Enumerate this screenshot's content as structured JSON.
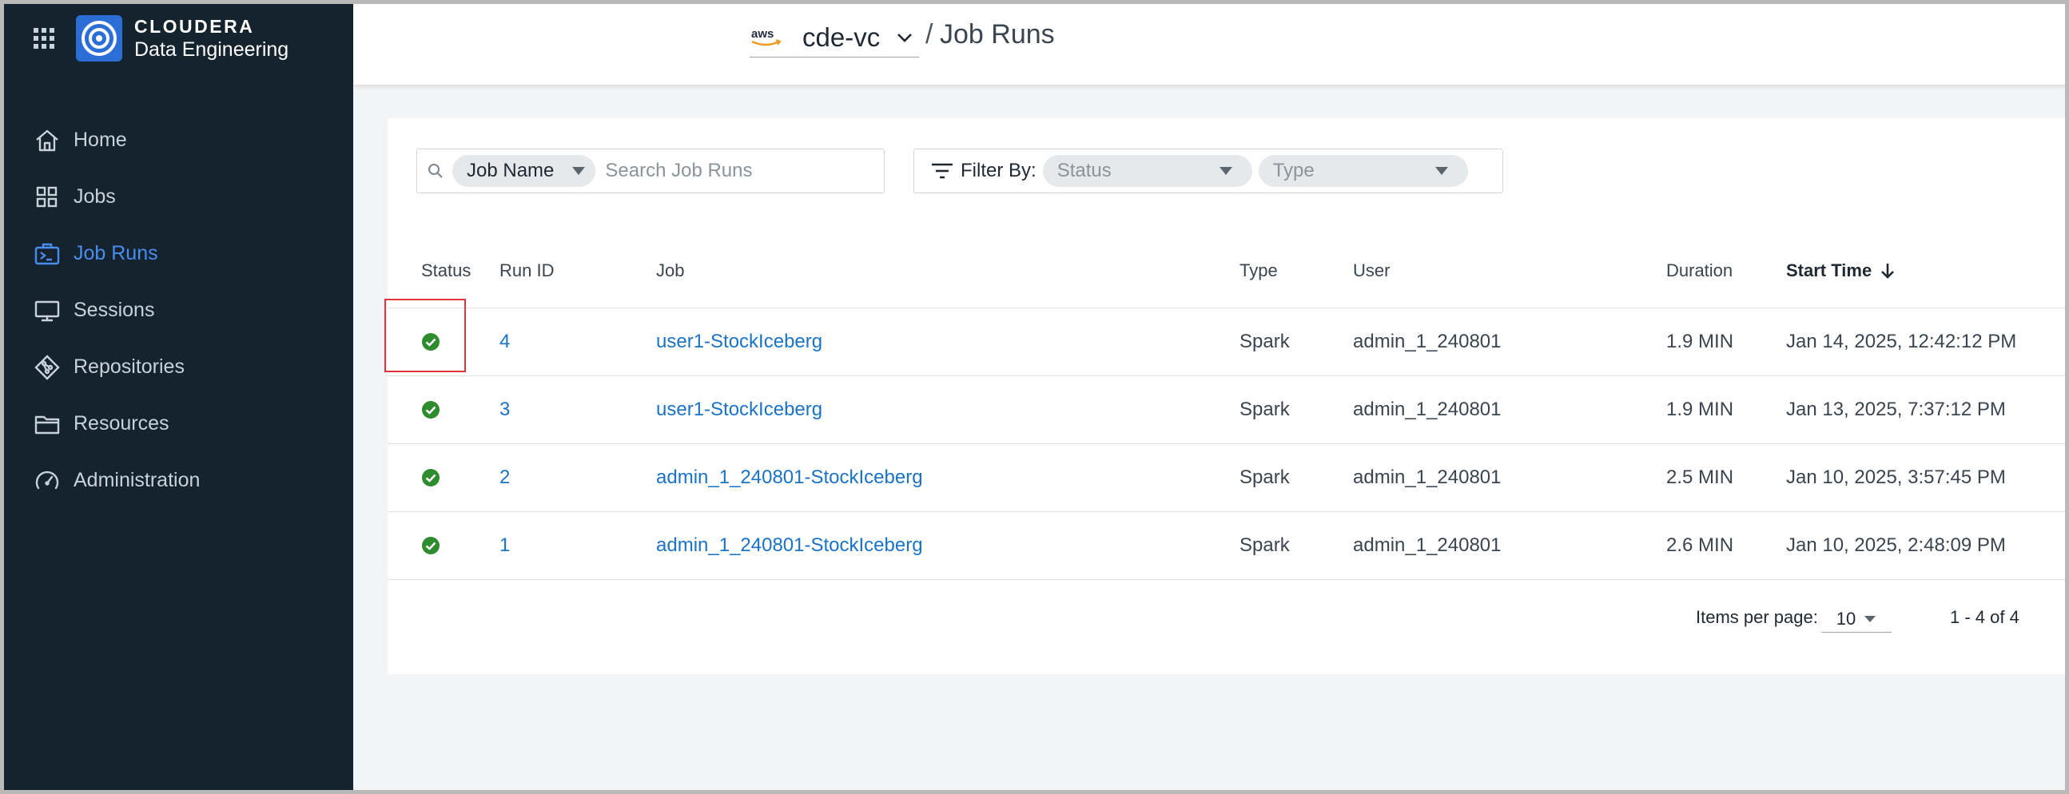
{
  "brand": {
    "title": "CLOUDERA",
    "subtitle": "Data Engineering"
  },
  "nav": [
    {
      "label": "Home",
      "icon": "home-icon",
      "active": false
    },
    {
      "label": "Jobs",
      "icon": "grid-icon",
      "active": false
    },
    {
      "label": "Job Runs",
      "icon": "job-runs-icon",
      "active": true
    },
    {
      "label": "Sessions",
      "icon": "monitor-icon",
      "active": false
    },
    {
      "label": "Repositories",
      "icon": "git-icon",
      "active": false
    },
    {
      "label": "Resources",
      "icon": "folder-icon",
      "active": false
    },
    {
      "label": "Administration",
      "icon": "gauge-icon",
      "active": false
    }
  ],
  "header": {
    "provider": "aws",
    "environment": "cde-vc",
    "separator": "/",
    "page_title": "Job Runs"
  },
  "search": {
    "field_label": "Job Name",
    "placeholder": "Search Job Runs"
  },
  "filter": {
    "label": "Filter By:",
    "status_placeholder": "Status",
    "type_placeholder": "Type"
  },
  "table": {
    "columns": {
      "status": "Status",
      "run_id": "Run ID",
      "job": "Job",
      "type": "Type",
      "user": "User",
      "duration": "Duration",
      "start_time": "Start Time"
    },
    "rows": [
      {
        "run_id": "4",
        "job": "user1-StockIceberg",
        "type": "Spark",
        "user": "admin_1_240801",
        "duration": "1.9 MIN",
        "start_time": "Jan 14, 2025, 12:42:12 PM",
        "status": "succeeded"
      },
      {
        "run_id": "3",
        "job": "user1-StockIceberg",
        "type": "Spark",
        "user": "admin_1_240801",
        "duration": "1.9 MIN",
        "start_time": "Jan 13, 2025, 7:37:12 PM",
        "status": "succeeded"
      },
      {
        "run_id": "2",
        "job": "admin_1_240801-StockIceberg",
        "type": "Spark",
        "user": "admin_1_240801",
        "duration": "2.5 MIN",
        "start_time": "Jan 10, 2025, 3:57:45 PM",
        "status": "succeeded"
      },
      {
        "run_id": "1",
        "job": "admin_1_240801-StockIceberg",
        "type": "Spark",
        "user": "admin_1_240801",
        "duration": "2.6 MIN",
        "start_time": "Jan 10, 2025, 2:48:09 PM",
        "status": "succeeded"
      }
    ]
  },
  "pagination": {
    "items_per_page_label": "Items per page:",
    "items_per_page": "10",
    "range": "1 - 4 of 4"
  },
  "colors": {
    "sidebar_bg": "#14232e",
    "accent": "#3b7ddd",
    "link": "#1a73c7",
    "success": "#2e8b2e",
    "highlight": "#e0353b"
  }
}
